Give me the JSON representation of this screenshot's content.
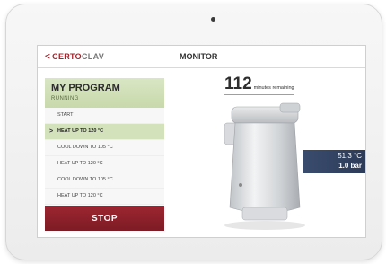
{
  "header": {
    "back_chevron": "<",
    "brand_prefix": "CERTO",
    "brand_suffix": "CLAV",
    "title": "MONITOR"
  },
  "program": {
    "name": "MY PROGRAM",
    "status": "RUNNING",
    "steps": [
      {
        "label": "START",
        "active": false
      },
      {
        "label": "HEAT UP TO 120 °C",
        "active": true
      },
      {
        "label": "COOL DOWN TO 105 °C",
        "active": false
      },
      {
        "label": "HEAT UP TO 120 °C",
        "active": false
      },
      {
        "label": "COOL DOWN TO 105 °C",
        "active": false
      },
      {
        "label": "HEAT UP TO 120 °C",
        "active": false
      }
    ],
    "active_marker": ">",
    "stop_label": "STOP"
  },
  "monitor": {
    "minutes_value": "112",
    "minutes_label": "minutes remaining",
    "temperature": "51.3 °C",
    "pressure": "1.0 bar"
  },
  "colors": {
    "accent_red": "#9c2631",
    "accent_green": "#c8d9ab",
    "readout_blue": "#2c3b58"
  },
  "icons": {
    "back": "chevron-left-icon",
    "device": "sterilizer-device-image"
  }
}
